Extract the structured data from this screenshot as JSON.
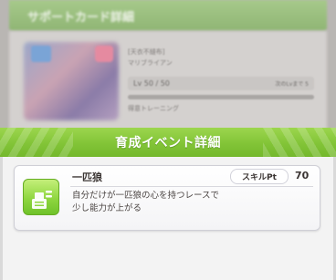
{
  "background_panel": {
    "title": "サポートカード詳細",
    "card_caption_line1": "[天衣不縫布]",
    "card_caption_line2": "マリブライアン",
    "level": "Lv 50 / 50",
    "level_side": "次のLvまで 5",
    "sub_label": "得意トレーニング"
  },
  "dialog": {
    "title": "育成イベント詳細"
  },
  "event": {
    "name": "一匹狼",
    "badge_label": "スキルPt",
    "value": "70",
    "desc_line1": "自分だけが一匹狼の心を持つレースで",
    "desc_line2": "少し能力が上がる",
    "icon": "skill-book-icon",
    "icon_color": "#8fd640"
  },
  "colors": {
    "header_green": "#82c437",
    "dialog_bg": "#f3f3f3"
  }
}
